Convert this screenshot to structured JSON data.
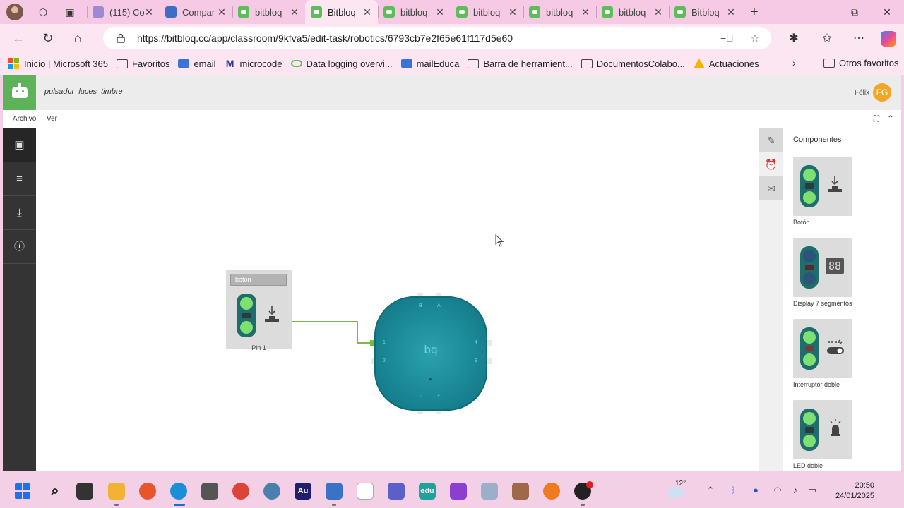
{
  "browser": {
    "tabs": [
      {
        "label": "(115) Co",
        "favicon": "mail-icon",
        "active": false
      },
      {
        "label": "Compar",
        "favicon": "puzzle-icon",
        "active": false
      },
      {
        "label": "bitbloq",
        "favicon": "bitbloq-icon",
        "active": false
      },
      {
        "label": "Bitbloq",
        "favicon": "bitbloq-icon",
        "active": true
      },
      {
        "label": "bitbloq",
        "favicon": "bitbloq-icon",
        "active": false
      },
      {
        "label": "bitbloq",
        "favicon": "bitbloq-icon",
        "active": false
      },
      {
        "label": "bitbloq",
        "favicon": "bitbloq-icon",
        "active": false
      },
      {
        "label": "bitbloq",
        "favicon": "bitbloq-icon",
        "active": false
      },
      {
        "label": "Bitbloq",
        "favicon": "bitbloq-icon",
        "active": false
      }
    ],
    "url": "https://bitbloq.cc/app/classroom/9kfva5/edit-task/robotics/6793cb7e2f65e61f117d5e60",
    "favorites": [
      {
        "label": "Inicio | Microsoft 365",
        "icon": "microsoft-icon"
      },
      {
        "label": "Favoritos",
        "icon": "folder-icon"
      },
      {
        "label": "email",
        "icon": "mail-icon"
      },
      {
        "label": "microcode",
        "icon": "m-icon"
      },
      {
        "label": "Data logging overvi...",
        "icon": "pill-icon"
      },
      {
        "label": "mailEduca",
        "icon": "mail-icon"
      },
      {
        "label": "Barra de herramient...",
        "icon": "folder-icon"
      },
      {
        "label": "DocumentosColabo...",
        "icon": "folder-icon"
      },
      {
        "label": "Actuaciones",
        "icon": "drive-icon"
      }
    ],
    "other_favorites": "Otros favoritos"
  },
  "app": {
    "doc_title": "pulsador_luces_timbre",
    "user_name": "Félix",
    "user_initials": "FG",
    "menu": [
      "Archivo",
      "Ver"
    ],
    "canvas_component": {
      "name": "boton",
      "pin": "Pin 1"
    },
    "board": {
      "logo": "bq",
      "pin_labels": {
        "top_left": "B",
        "top_right": "A",
        "left_top": "1",
        "left_bottom": "2",
        "right_top": "4",
        "right_bottom": "3",
        "bottom_left": "-",
        "bottom_right": "+"
      }
    },
    "panel": {
      "title": "Componentes",
      "components": [
        "Botón",
        "Display 7 segmentos",
        "Interruptor doble",
        "LED doble"
      ]
    }
  },
  "taskbar": {
    "weather": "12°",
    "time": "20:50",
    "date": "24/01/2025"
  },
  "colors": {
    "accent_green": "#5db35a",
    "board_teal": "#1a8896",
    "wire_green": "#7bb84f",
    "avatar_orange": "#f5a524"
  }
}
